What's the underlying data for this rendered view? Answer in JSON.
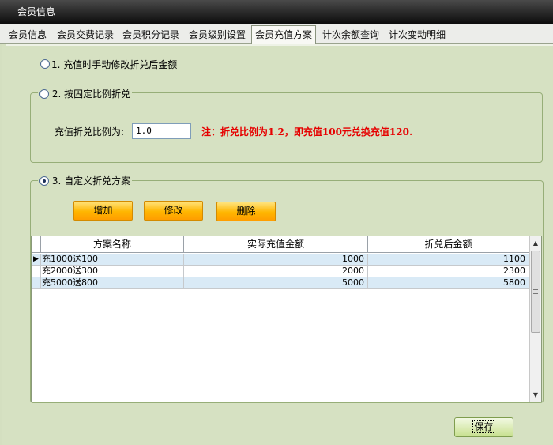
{
  "window": {
    "title": "会员信息"
  },
  "tabs": [
    {
      "label": "会员信息"
    },
    {
      "label": "会员交费记录"
    },
    {
      "label": "会员积分记录"
    },
    {
      "label": "会员级别设置"
    },
    {
      "label": "会员充值方案"
    },
    {
      "label": "计次余额查询"
    },
    {
      "label": "计次变动明细"
    }
  ],
  "options": {
    "opt1": {
      "label": "1. 充值时手动修改折兑后金额",
      "checked": false
    },
    "opt2": {
      "label": "2. 按固定比例折兑",
      "checked": false
    },
    "opt3": {
      "label": "3. 自定义折兑方案",
      "checked": true
    }
  },
  "ratio": {
    "label": "充值折兑比例为:",
    "value": "1.0",
    "note": "注：折兑比例为1.2，即充值100元兑换充值120."
  },
  "buttons": {
    "add": "增加",
    "edit": "修改",
    "delete": "删除",
    "save": "保存"
  },
  "table": {
    "headers": [
      "方案名称",
      "实际充值金额",
      "折兑后金额"
    ],
    "rows": [
      {
        "name": "充1000送100",
        "amount": "1000",
        "discounted": "1100",
        "selected": true
      },
      {
        "name": "充2000送300",
        "amount": "2000",
        "discounted": "2300",
        "selected": false
      },
      {
        "name": "充5000送800",
        "amount": "5000",
        "discounted": "5800",
        "selected": false
      }
    ]
  },
  "icons": {
    "row_pointer": "triangle-right",
    "scroll_up": "triangle-up",
    "scroll_down": "triangle-down"
  }
}
